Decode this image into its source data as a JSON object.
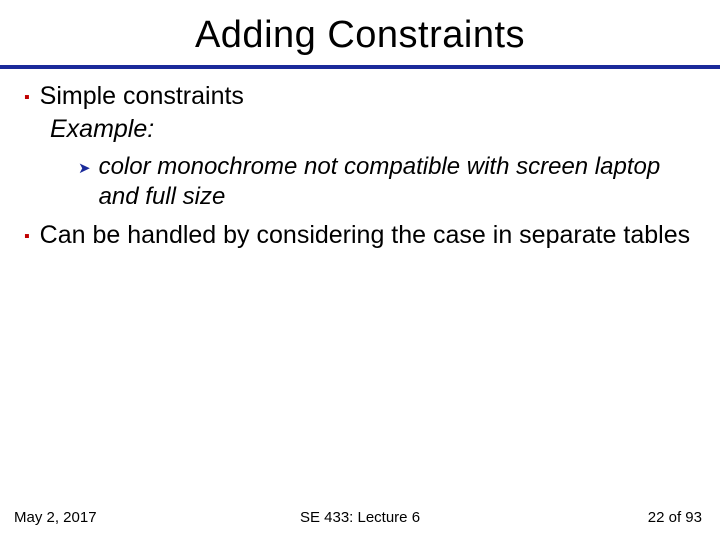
{
  "title": "Adding Constraints",
  "bullets": {
    "b1": {
      "text": "Simple constraints",
      "example": "Example:"
    },
    "sub1": {
      "text": "color monochrome not compatible with screen laptop and full size"
    },
    "b2": {
      "text": "Can be handled by considering the case in separate tables"
    }
  },
  "footer": {
    "date": "May 2, 2017",
    "course": "SE 433: Lecture 6",
    "page": "22 of 93"
  }
}
